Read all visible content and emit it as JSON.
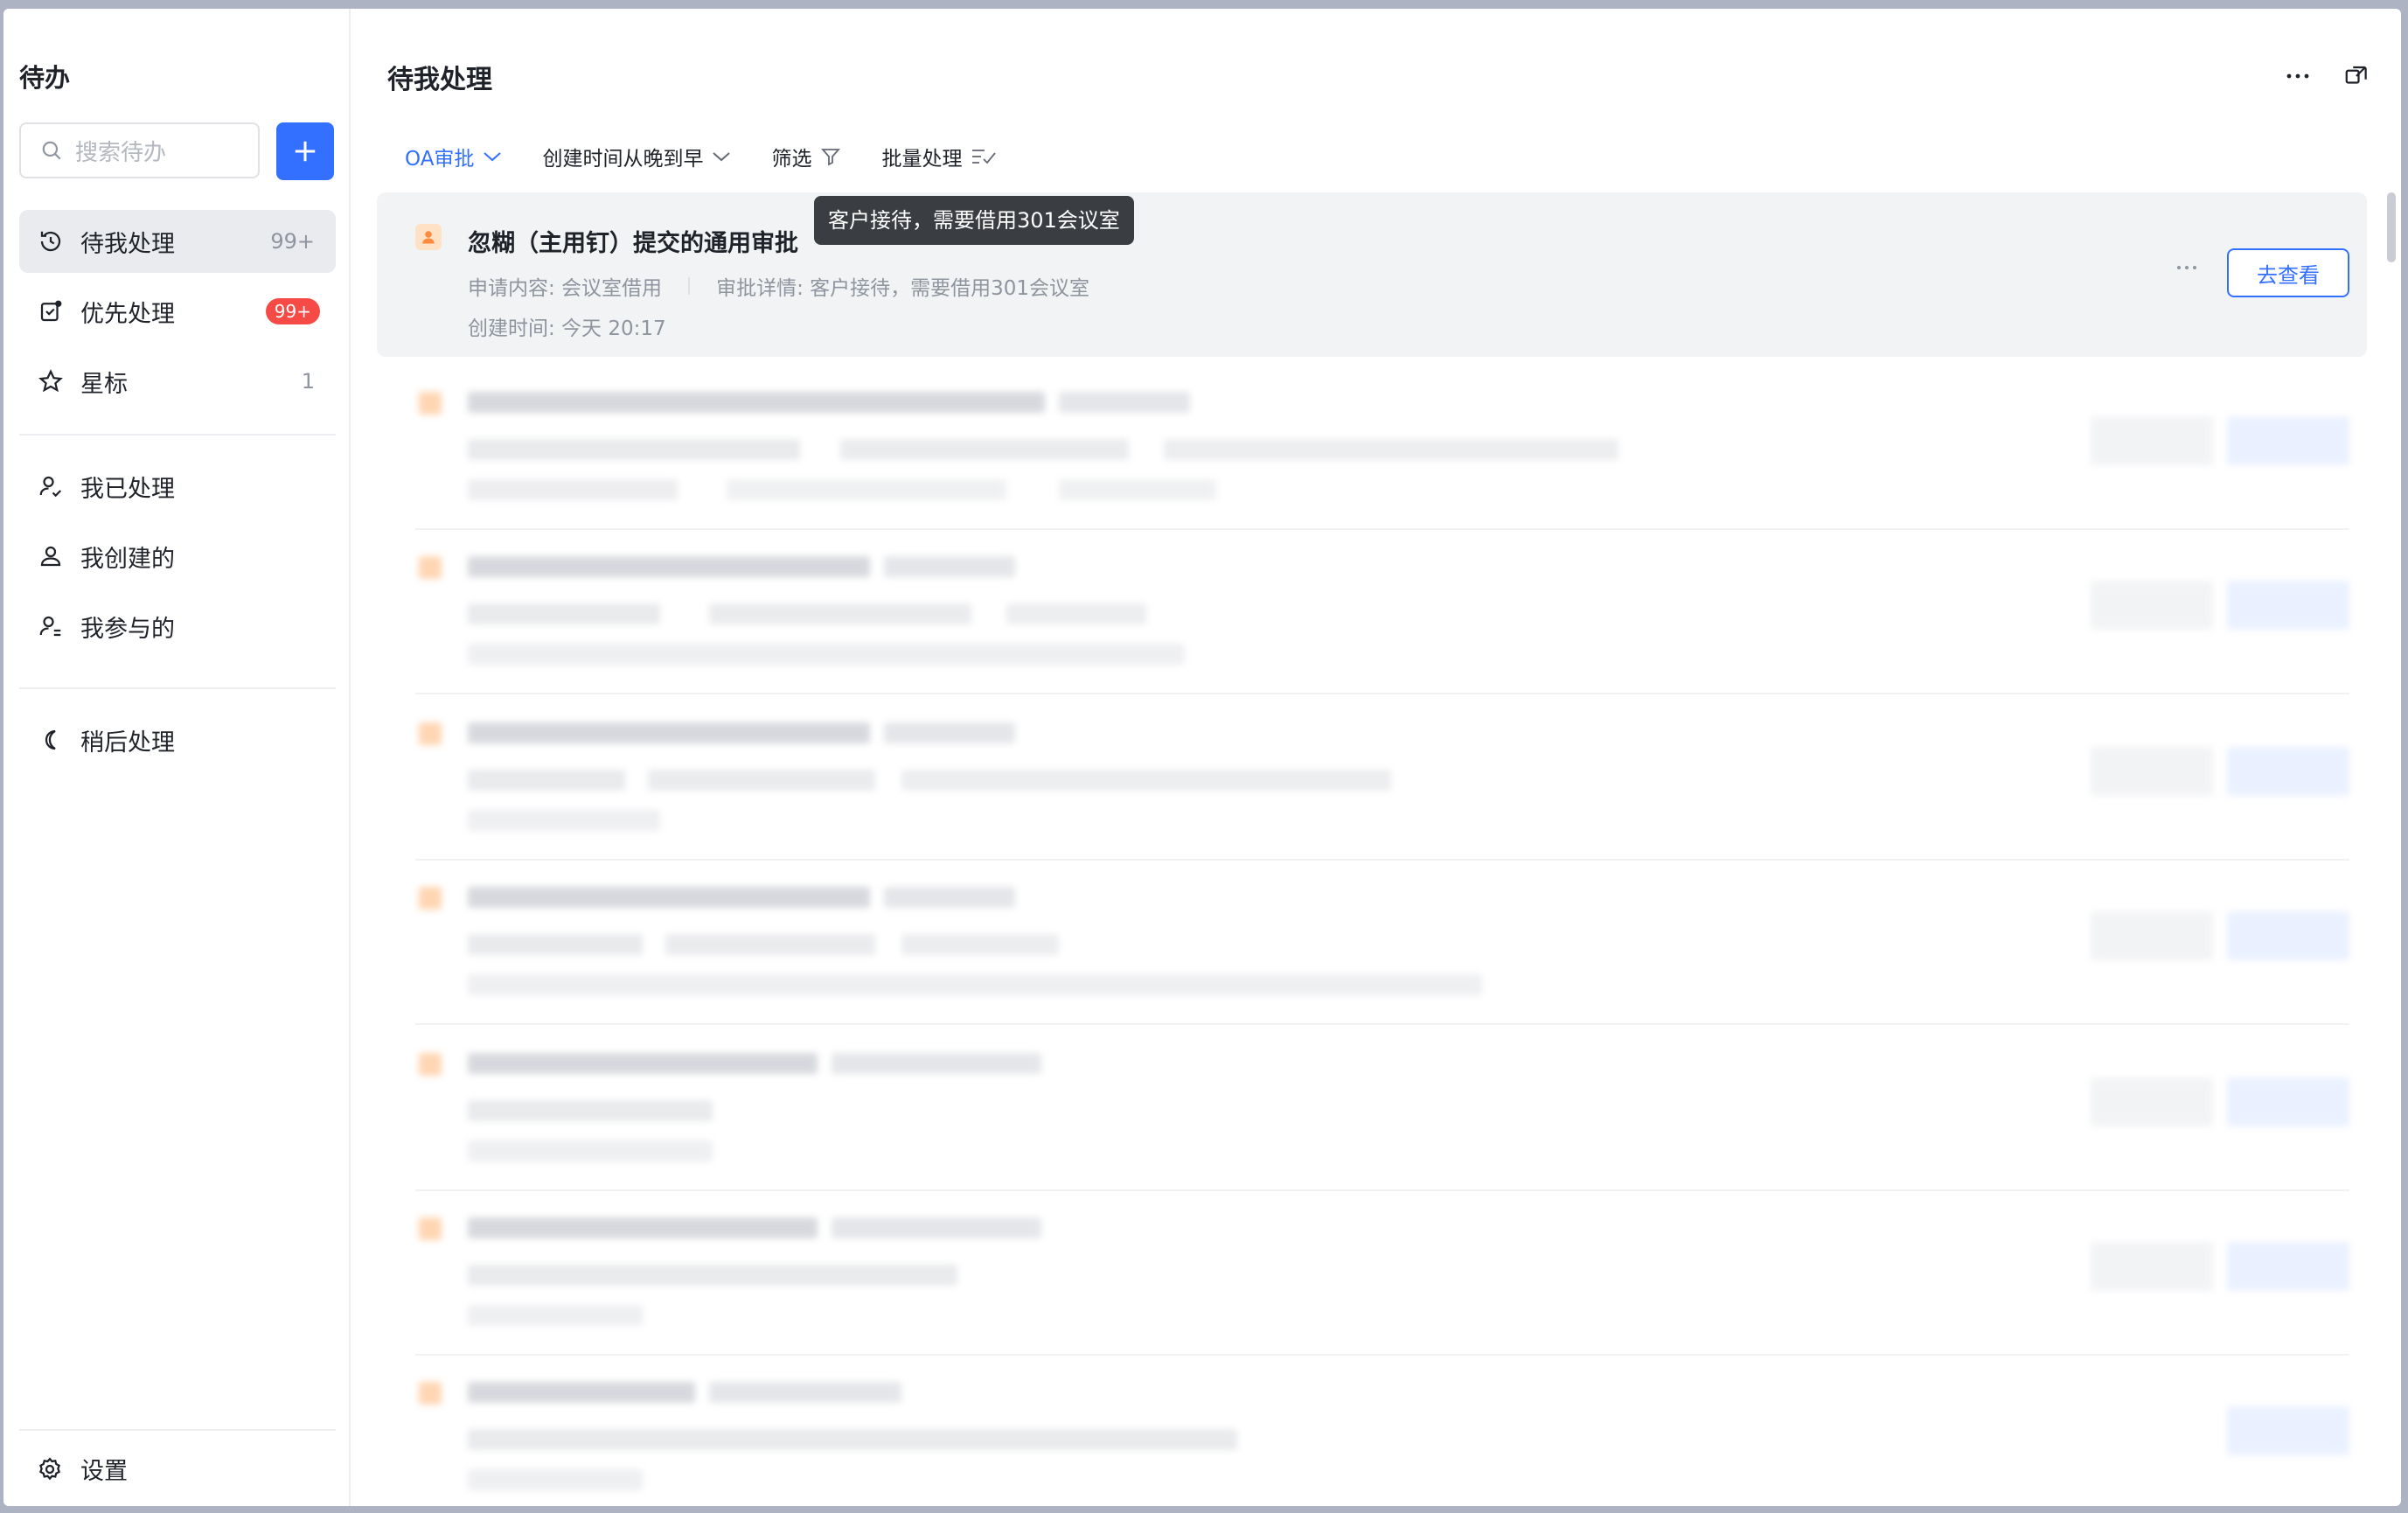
{
  "sidebar": {
    "title": "待办",
    "search_placeholder": "搜索待办",
    "items": [
      {
        "label": "待我处理",
        "count": "99+"
      },
      {
        "label": "优先处理",
        "badge": "99+"
      },
      {
        "label": "星标",
        "count": "1"
      },
      {
        "label": "我已处理"
      },
      {
        "label": "我创建的"
      },
      {
        "label": "我参与的"
      },
      {
        "label": "稍后处理"
      }
    ],
    "settings_label": "设置"
  },
  "main": {
    "title": "待我处理",
    "toolbar": {
      "filter_type": "OA审批",
      "sort": "创建时间从晚到早",
      "filter": "筛选",
      "batch": "批量处理"
    },
    "first_card": {
      "title": "忽糊（主用钉）提交的通用审批",
      "content": "申请内容: 会议室借用",
      "detail": "审批详情: 客户接待，需要借用301会议室",
      "created": "创建时间: 今天 20:17",
      "view_label": "去查看",
      "tooltip": "客户接待，需要借用301会议室"
    }
  },
  "colors": {
    "accent": "#3370ff",
    "badge": "#f54a45",
    "avatar_bg": "#ffe2c6"
  }
}
